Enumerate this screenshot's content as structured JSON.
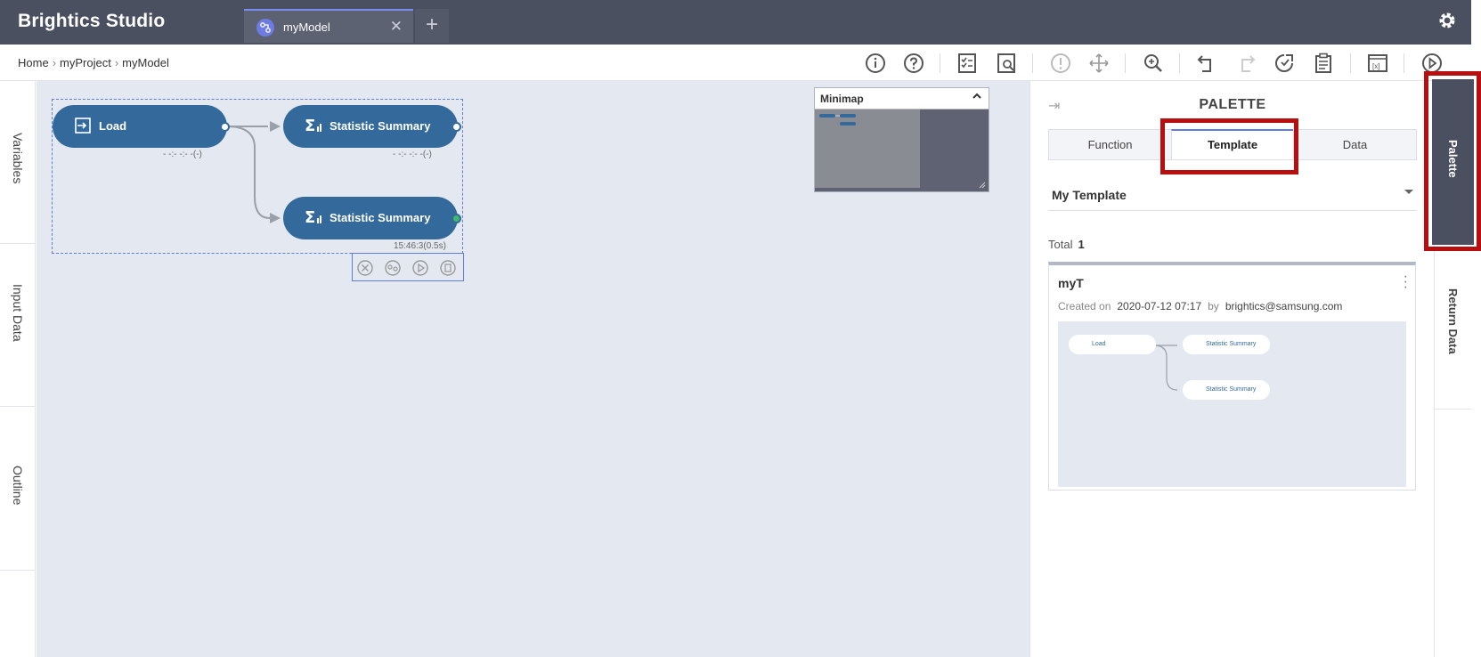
{
  "app": {
    "title": "Brightics Studio"
  },
  "tabs": [
    {
      "label": "myModel"
    }
  ],
  "breadcrumb": {
    "items": [
      "Home",
      "myProject",
      "myModel"
    ]
  },
  "toolbar_icons": [
    "info-icon",
    "help-icon",
    "checklist-icon",
    "report-icon",
    "validate-icon",
    "move-icon",
    "zoom-icon",
    "undo-icon",
    "redo-icon",
    "run-history-icon",
    "clipboard-icon",
    "variables-window-icon",
    "run-icon"
  ],
  "left_panel": {
    "tabs": [
      "Variables",
      "Input Data",
      "Outline"
    ]
  },
  "canvas": {
    "nodes": [
      {
        "label": "Load",
        "status": "- -:- -:- -(-)"
      },
      {
        "label": "Statistic Summary",
        "status": "- -:- -:- -(-)"
      },
      {
        "label": "Statistic Summary",
        "status": "15:46:3(0.5s)"
      }
    ],
    "minimap": {
      "title": "Minimap"
    }
  },
  "palette": {
    "title": "PALETTE",
    "tabs": [
      "Function",
      "Template",
      "Data"
    ],
    "active_tab": "Template",
    "dropdown_value": "My Template",
    "total_label": "Total",
    "total_value": "1",
    "card": {
      "name": "myT",
      "created_label": "Created on",
      "created_value": "2020-07-12 07:17",
      "by_label": "by",
      "author": "brightics@samsung.com",
      "preview_nodes": [
        "Load",
        "Statistic Summary",
        "Statistic Summary"
      ]
    }
  },
  "right_panel": {
    "tabs": [
      "Palette",
      "Return Data"
    ]
  },
  "colors": {
    "topbar": "#4b5060",
    "node": "#336a9b",
    "highlight": "#b70f0f",
    "canvas": "#e4e8f0"
  }
}
